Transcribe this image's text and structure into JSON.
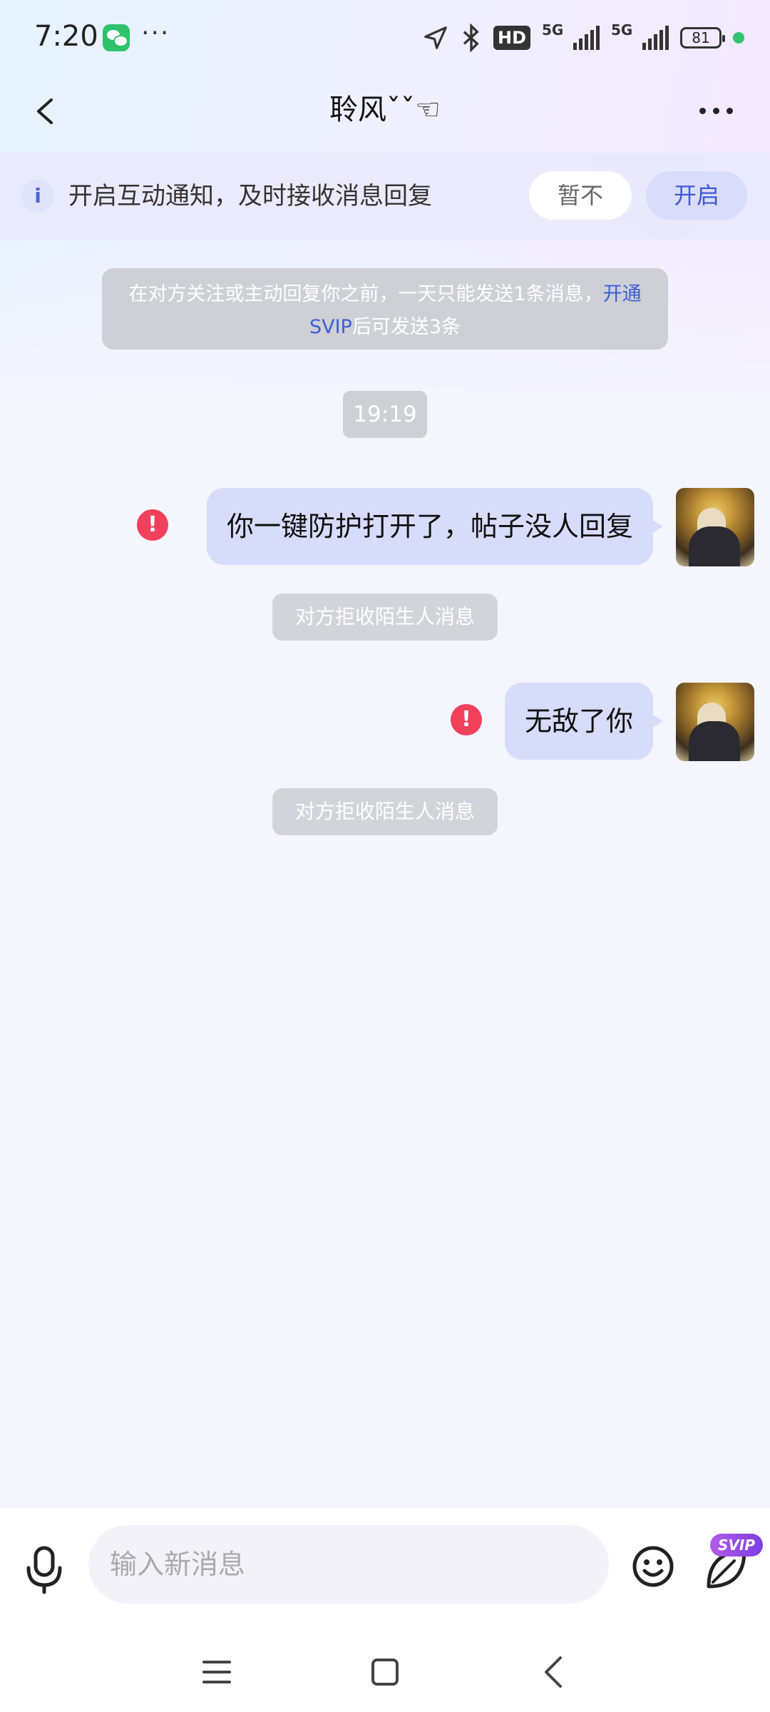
{
  "status_bar": {
    "time": "7:20",
    "more": "···",
    "hd": "HD",
    "signal_1": "5G",
    "signal_2": "5G",
    "battery": "81"
  },
  "header": {
    "title": "聆风ˇˇ☜"
  },
  "notice": {
    "text": "开启互动通知，及时接收消息回复",
    "later": "暂不",
    "enable": "开启"
  },
  "tip": {
    "text": "在对方关注或主动回复你之前，一天只能发送1条消息，",
    "link": "开通SVIP",
    "suffix": "后可发送3条"
  },
  "timestamp": "19:19",
  "messages": [
    {
      "text": "你一键防护打开了，帖子没人回复",
      "status": "!",
      "system": "对方拒收陌生人消息"
    },
    {
      "text": "无敌了你",
      "status": "!",
      "system": "对方拒收陌生人消息"
    }
  ],
  "input": {
    "placeholder": "输入新消息",
    "svip": "SVIP"
  },
  "colors": {
    "accent": "#3f57d1",
    "bubble": "#d7dcfb",
    "error": "#f0405a"
  }
}
